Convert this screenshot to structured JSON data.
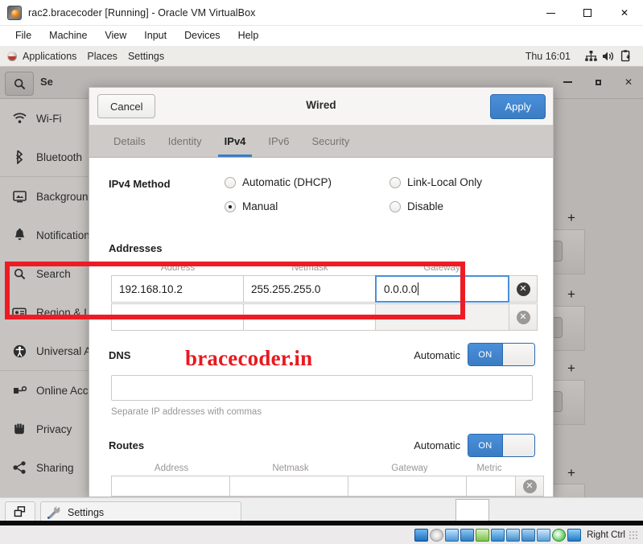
{
  "host_window": {
    "title": "rac2.bracecoder [Running] - Oracle VM VirtualBox",
    "icon": "virtualbox-icon",
    "controls": {
      "minimize": "minimize-icon",
      "maximize": "maximize-icon",
      "close": "✕"
    },
    "menus": [
      "File",
      "Machine",
      "View",
      "Input",
      "Devices",
      "Help"
    ]
  },
  "gnome_topbar": {
    "items": [
      "Applications",
      "Places",
      "Settings"
    ],
    "clock": "Thu 16:01",
    "tray": [
      "network-icon",
      "volume-icon",
      "clipboard-icon"
    ]
  },
  "settings_app": {
    "title": "Settings",
    "title_visible": "Se",
    "search_icon": "search-icon",
    "window_controls": {
      "minimize": "minimize-icon",
      "maximize": "maximize-icon",
      "close": "✕"
    },
    "sidebar": [
      {
        "label": "Wi-Fi",
        "icon": "wifi-icon"
      },
      {
        "label": "Bluetooth",
        "icon": "bluetooth-icon"
      },
      {
        "label": "Background",
        "icon": "background-icon"
      },
      {
        "label": "Notifications",
        "icon": "bell-icon"
      },
      {
        "label": "Search",
        "icon": "search-icon"
      },
      {
        "label": "Region & L",
        "icon": "keyboard-icon"
      },
      {
        "label": "Universal A",
        "icon": "accessibility-icon"
      },
      {
        "label": "Online Acc",
        "icon": "online-accounts-icon"
      },
      {
        "label": "Privacy",
        "icon": "hand-icon"
      },
      {
        "label": "Sharing",
        "icon": "share-icon"
      }
    ],
    "add_buttons": [
      "+",
      "+",
      "+",
      "+"
    ]
  },
  "dialog": {
    "title": "Wired",
    "cancel_label": "Cancel",
    "apply_label": "Apply",
    "tabs": [
      {
        "label": "Details",
        "active": false
      },
      {
        "label": "Identity",
        "active": false
      },
      {
        "label": "IPv4",
        "active": true
      },
      {
        "label": "IPv6",
        "active": false
      },
      {
        "label": "Security",
        "active": false
      }
    ],
    "ipv4_method": {
      "label": "IPv4 Method",
      "options": [
        {
          "label": "Automatic (DHCP)",
          "selected": false
        },
        {
          "label": "Link-Local Only",
          "selected": false
        },
        {
          "label": "Manual",
          "selected": true
        },
        {
          "label": "Disable",
          "selected": false
        }
      ]
    },
    "addresses": {
      "title": "Addresses",
      "headers": [
        "Address",
        "Netmask",
        "Gateway"
      ],
      "rows": [
        {
          "address": "192.168.10.2",
          "netmask": "255.255.255.0",
          "gateway": "0.0.0.0",
          "focused_field": "gateway",
          "delete_icon": "delete-circle-icon"
        },
        {
          "address": "",
          "netmask": "",
          "gateway": "",
          "focused_field": "",
          "delete_icon": "delete-circle-icon"
        }
      ]
    },
    "dns": {
      "title": "DNS",
      "automatic_label": "Automatic",
      "toggle_state": "ON",
      "value": "",
      "hint": "Separate IP addresses with commas"
    },
    "routes": {
      "title": "Routes",
      "automatic_label": "Automatic",
      "toggle_state": "ON",
      "headers": [
        "Address",
        "Netmask",
        "Gateway",
        "Metric"
      ],
      "rows": [
        {
          "address": "",
          "netmask": "",
          "gateway": "",
          "metric": "",
          "delete_icon": "delete-circle-icon"
        }
      ]
    },
    "highlight_color": "#ed1c24",
    "accent_color": "#3b7cc4"
  },
  "watermark": {
    "text": "bracecoder.in",
    "color": "#e8191e"
  },
  "taskbar": {
    "show_desktop_icon": "restore-windows-icon",
    "tasks": [
      {
        "label": "Settings",
        "icon": "settings-tools-icon"
      }
    ]
  },
  "vbox_statusbar": {
    "host_key_label": "Right Ctrl",
    "icons": [
      "hard-disk-icon",
      "optical-disk-icon",
      "audio-icon",
      "network-icon",
      "usb-icon",
      "shared-folders-icon",
      "display-icon",
      "recording-icon",
      "virtualization-icon",
      "mouse-integration-icon",
      "host-key-icon"
    ]
  }
}
